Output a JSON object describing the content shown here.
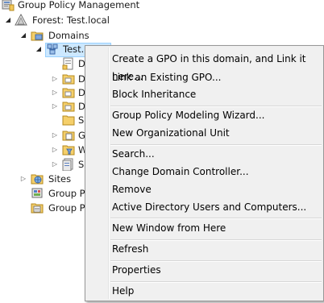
{
  "tree": {
    "root": "Group Policy Management",
    "forest": "Forest: Test.local",
    "domains": "Domains",
    "domain": "Test.local",
    "hidden_children": [
      "D",
      "D",
      "D",
      "D",
      "S",
      "G",
      "W",
      "S"
    ],
    "sites": "Sites",
    "gp_modeling": "Group P",
    "gp_results": "Group P"
  },
  "context_menu": {
    "items": [
      "Create a GPO in this domain, and Link it here...",
      "Link an Existing GPO...",
      "Block Inheritance",
      "Group Policy Modeling Wizard...",
      "New Organizational Unit",
      "Search...",
      "Change Domain Controller...",
      "Remove",
      "Active Directory Users and Computers...",
      "New Window from Here",
      "Refresh",
      "Properties",
      "Help"
    ]
  }
}
